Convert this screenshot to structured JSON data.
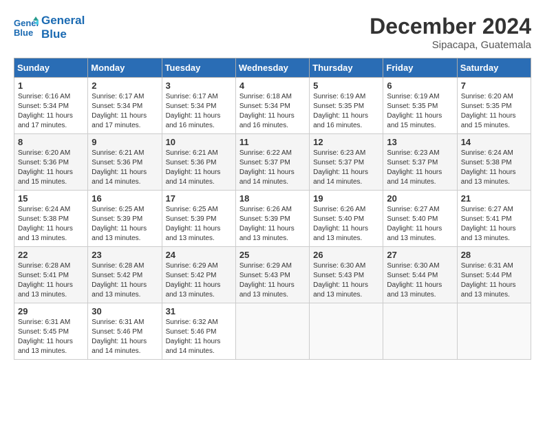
{
  "header": {
    "logo_line1": "General",
    "logo_line2": "Blue",
    "month": "December 2024",
    "location": "Sipacapa, Guatemala"
  },
  "days_of_week": [
    "Sunday",
    "Monday",
    "Tuesday",
    "Wednesday",
    "Thursday",
    "Friday",
    "Saturday"
  ],
  "weeks": [
    [
      {
        "day": 1,
        "info": "Sunrise: 6:16 AM\nSunset: 5:34 PM\nDaylight: 11 hours\nand 17 minutes."
      },
      {
        "day": 2,
        "info": "Sunrise: 6:17 AM\nSunset: 5:34 PM\nDaylight: 11 hours\nand 17 minutes."
      },
      {
        "day": 3,
        "info": "Sunrise: 6:17 AM\nSunset: 5:34 PM\nDaylight: 11 hours\nand 16 minutes."
      },
      {
        "day": 4,
        "info": "Sunrise: 6:18 AM\nSunset: 5:34 PM\nDaylight: 11 hours\nand 16 minutes."
      },
      {
        "day": 5,
        "info": "Sunrise: 6:19 AM\nSunset: 5:35 PM\nDaylight: 11 hours\nand 16 minutes."
      },
      {
        "day": 6,
        "info": "Sunrise: 6:19 AM\nSunset: 5:35 PM\nDaylight: 11 hours\nand 15 minutes."
      },
      {
        "day": 7,
        "info": "Sunrise: 6:20 AM\nSunset: 5:35 PM\nDaylight: 11 hours\nand 15 minutes."
      }
    ],
    [
      {
        "day": 8,
        "info": "Sunrise: 6:20 AM\nSunset: 5:36 PM\nDaylight: 11 hours\nand 15 minutes."
      },
      {
        "day": 9,
        "info": "Sunrise: 6:21 AM\nSunset: 5:36 PM\nDaylight: 11 hours\nand 14 minutes."
      },
      {
        "day": 10,
        "info": "Sunrise: 6:21 AM\nSunset: 5:36 PM\nDaylight: 11 hours\nand 14 minutes."
      },
      {
        "day": 11,
        "info": "Sunrise: 6:22 AM\nSunset: 5:37 PM\nDaylight: 11 hours\nand 14 minutes."
      },
      {
        "day": 12,
        "info": "Sunrise: 6:23 AM\nSunset: 5:37 PM\nDaylight: 11 hours\nand 14 minutes."
      },
      {
        "day": 13,
        "info": "Sunrise: 6:23 AM\nSunset: 5:37 PM\nDaylight: 11 hours\nand 14 minutes."
      },
      {
        "day": 14,
        "info": "Sunrise: 6:24 AM\nSunset: 5:38 PM\nDaylight: 11 hours\nand 13 minutes."
      }
    ],
    [
      {
        "day": 15,
        "info": "Sunrise: 6:24 AM\nSunset: 5:38 PM\nDaylight: 11 hours\nand 13 minutes."
      },
      {
        "day": 16,
        "info": "Sunrise: 6:25 AM\nSunset: 5:39 PM\nDaylight: 11 hours\nand 13 minutes."
      },
      {
        "day": 17,
        "info": "Sunrise: 6:25 AM\nSunset: 5:39 PM\nDaylight: 11 hours\nand 13 minutes."
      },
      {
        "day": 18,
        "info": "Sunrise: 6:26 AM\nSunset: 5:39 PM\nDaylight: 11 hours\nand 13 minutes."
      },
      {
        "day": 19,
        "info": "Sunrise: 6:26 AM\nSunset: 5:40 PM\nDaylight: 11 hours\nand 13 minutes."
      },
      {
        "day": 20,
        "info": "Sunrise: 6:27 AM\nSunset: 5:40 PM\nDaylight: 11 hours\nand 13 minutes."
      },
      {
        "day": 21,
        "info": "Sunrise: 6:27 AM\nSunset: 5:41 PM\nDaylight: 11 hours\nand 13 minutes."
      }
    ],
    [
      {
        "day": 22,
        "info": "Sunrise: 6:28 AM\nSunset: 5:41 PM\nDaylight: 11 hours\nand 13 minutes."
      },
      {
        "day": 23,
        "info": "Sunrise: 6:28 AM\nSunset: 5:42 PM\nDaylight: 11 hours\nand 13 minutes."
      },
      {
        "day": 24,
        "info": "Sunrise: 6:29 AM\nSunset: 5:42 PM\nDaylight: 11 hours\nand 13 minutes."
      },
      {
        "day": 25,
        "info": "Sunrise: 6:29 AM\nSunset: 5:43 PM\nDaylight: 11 hours\nand 13 minutes."
      },
      {
        "day": 26,
        "info": "Sunrise: 6:30 AM\nSunset: 5:43 PM\nDaylight: 11 hours\nand 13 minutes."
      },
      {
        "day": 27,
        "info": "Sunrise: 6:30 AM\nSunset: 5:44 PM\nDaylight: 11 hours\nand 13 minutes."
      },
      {
        "day": 28,
        "info": "Sunrise: 6:31 AM\nSunset: 5:44 PM\nDaylight: 11 hours\nand 13 minutes."
      }
    ],
    [
      {
        "day": 29,
        "info": "Sunrise: 6:31 AM\nSunset: 5:45 PM\nDaylight: 11 hours\nand 13 minutes."
      },
      {
        "day": 30,
        "info": "Sunrise: 6:31 AM\nSunset: 5:46 PM\nDaylight: 11 hours\nand 14 minutes."
      },
      {
        "day": 31,
        "info": "Sunrise: 6:32 AM\nSunset: 5:46 PM\nDaylight: 11 hours\nand 14 minutes."
      },
      null,
      null,
      null,
      null
    ]
  ]
}
